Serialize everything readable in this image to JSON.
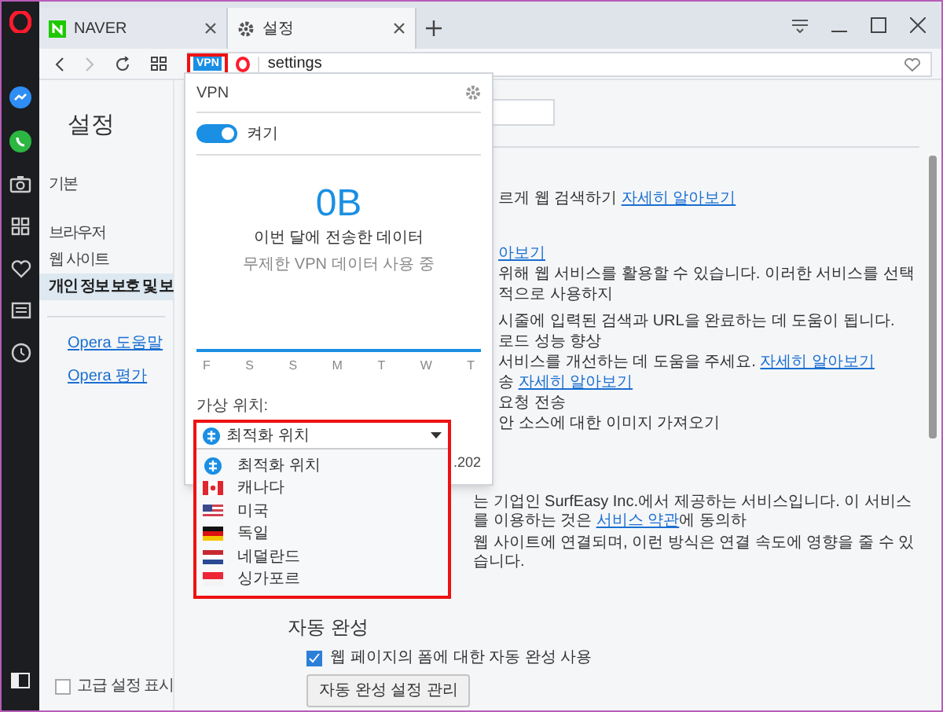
{
  "tabs": [
    {
      "label": "NAVER",
      "kind": "naver",
      "selected": false
    },
    {
      "label": "설정",
      "kind": "gear",
      "selected": true
    }
  ],
  "address_bar": {
    "vpn_badge": "VPN",
    "url": "settings"
  },
  "settings_nav": {
    "title": "설정",
    "items": [
      {
        "label": "기본",
        "selected": false
      },
      {
        "label": "브라우저",
        "selected": false
      },
      {
        "label": "웹 사이트",
        "selected": false
      },
      {
        "label": "개인 정보 보호 및 보",
        "selected": true
      }
    ],
    "links": [
      "Opera 도움말",
      "Opera 평가"
    ],
    "advanced": {
      "label": "고급 설정 표시",
      "checked": false
    }
  },
  "content": {
    "lines": [
      {
        "text": "르게 웹 검색하기 ",
        "link": "자세히 알아보기"
      },
      {
        "link": "아보기"
      },
      {
        "text": "위해 웹 서비스를 활용할 수 있습니다. 이러한 서비스를 선택적으로 사용하지"
      },
      {
        "text": "시줄에 입력된 검색과 URL을 완료하는 데 도움이 됩니다."
      },
      {
        "text": "로드 성능 향상"
      },
      {
        "text": "서비스를 개선하는 데 도움을 주세요. ",
        "link": "자세히 알아보기"
      },
      {
        "text": "송 ",
        "link": "자세히 알아보기"
      },
      {
        "text": "요청 전송"
      },
      {
        "text": "안 소스에 대한 이미지 가져오기"
      }
    ],
    "lower_lines": [
      {
        "text": "는 기업인 SurfEasy Inc.에서 제공하는 서비스입니다. 이 서비스를 이용하는 것은 ",
        "link": "서비스 약관",
        "after": "에 동의하"
      },
      {
        "text": "웹 사이트에 연결되며, 이런 방식은 연결 속도에 영향을 줄 수 있습니다."
      }
    ],
    "autofill": {
      "heading": "자동 완성",
      "checkbox": {
        "label": "웹 페이지의 폼에 대한 자동 완성 사용",
        "checked": true
      },
      "button": "자동 완성 설정 관리"
    }
  },
  "vpn_popup": {
    "title": "VPN",
    "toggle": {
      "label": "켜기",
      "on": true
    },
    "data_amount": "0B",
    "data_caption": "이번 달에 전송한 데이터",
    "data_note": "무제한 VPN 데이터 사용 중",
    "chart_days": [
      "F",
      "S",
      "S",
      "M",
      "T",
      "W",
      "T"
    ],
    "location_label": "가상 위치:",
    "selected_location": "최적화 위치",
    "ip_fragment": ".202",
    "options": [
      {
        "label": "최적화 위치",
        "kind": "optimal"
      },
      {
        "label": "캐나다",
        "kind": "ca"
      },
      {
        "label": "미국",
        "kind": "us"
      },
      {
        "label": "독일",
        "kind": "de"
      },
      {
        "label": "네덜란드",
        "kind": "nl"
      },
      {
        "label": "싱가포르",
        "kind": "sg"
      }
    ]
  }
}
